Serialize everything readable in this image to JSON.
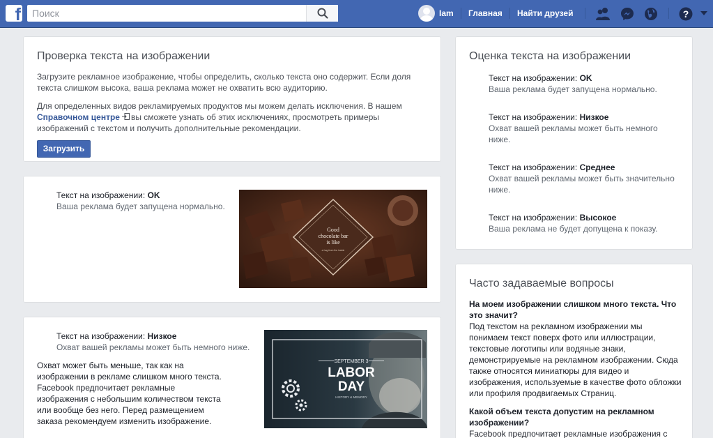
{
  "header": {
    "search_placeholder": "Поиск",
    "user_name": "Iam",
    "nav_home": "Главная",
    "nav_find_friends": "Найти друзей",
    "icons": [
      "friends-icon",
      "messenger-icon",
      "globe-icon",
      "help-icon",
      "dropdown-arrow-icon"
    ]
  },
  "check_card": {
    "title": "Проверка текста на изображении",
    "para1": "Загрузите рекламное изображение, чтобы определить, сколько текста оно содержит. Если доля текста слишком высока, ваша реклама может не охватить всю аудиторию.",
    "para2_before": "Для определенных видов рекламируемых продуктов мы можем делать исключения. В нашем",
    "para2_link": "Справочном центре",
    "para2_after": "вы сможете узнать об этих исключениях, просмотреть примеры изображений с текстом и получить дополнительные рекомендации.",
    "upload_button": "Загрузить"
  },
  "example_ok": {
    "label_prefix": "Текст на изображении:",
    "label_value": "OK",
    "desc": "Ваша реклама будет запущена нормально.",
    "image_text_line1": "Good",
    "image_text_line2": "chocolate bar",
    "image_text_line3": "is like",
    "image_text_small": "a hug from the inside"
  },
  "example_low": {
    "label_prefix": "Текст на изображении:",
    "label_value": "Низкое",
    "desc": "Охват вашей рекламы может быть немного ниже.",
    "body": "Охват может быть меньше, так как на изображении в рекламе слишком много текста. Facebook предпочитает рекламные изображения с небольшим количеством текста или вообще без него. Перед размещением заказа рекомендуем изменить изображение.",
    "image_date": "SEPTEMBER 3",
    "image_title1": "LABOR",
    "image_title2": "DAY",
    "image_subtitle": "HISTORY & MEMORY"
  },
  "rating_card": {
    "title": "Оценка текста на изображении",
    "items": [
      {
        "prefix": "Текст на изображении:",
        "value": "OK",
        "desc": "Ваша реклама будет запущена нормально."
      },
      {
        "prefix": "Текст на изображении:",
        "value": "Низкое",
        "desc": "Охват вашей рекламы может быть немного ниже."
      },
      {
        "prefix": "Текст на изображении:",
        "value": "Среднее",
        "desc": "Охват вашей рекламы может быть значительно ниже."
      },
      {
        "prefix": "Текст на изображении:",
        "value": "Высокое",
        "desc": "Ваша реклама не будет допущена к показу."
      }
    ]
  },
  "faq_card": {
    "title": "Часто задаваемые вопросы",
    "q1": "На моем изображении слишком много текста. Что это значит?",
    "a1": "Под текстом на рекламном изображении мы понимаем текст поверх фото или иллюстрации, текстовые логотипы или водяные знаки, демонстрируемые на рекламном изображении. Сюда также относятся миниатюры для видео и изображения, используемые в качестве фото обложки или профиля продвигаемых Страниц.",
    "q2": "Какой объем текста допустим на рекламном изображении?",
    "a2": "Facebook предпочитает рекламные изображения с"
  },
  "colors": {
    "brand": "#4267b2",
    "link": "#365899",
    "background": "#e9ebee"
  }
}
